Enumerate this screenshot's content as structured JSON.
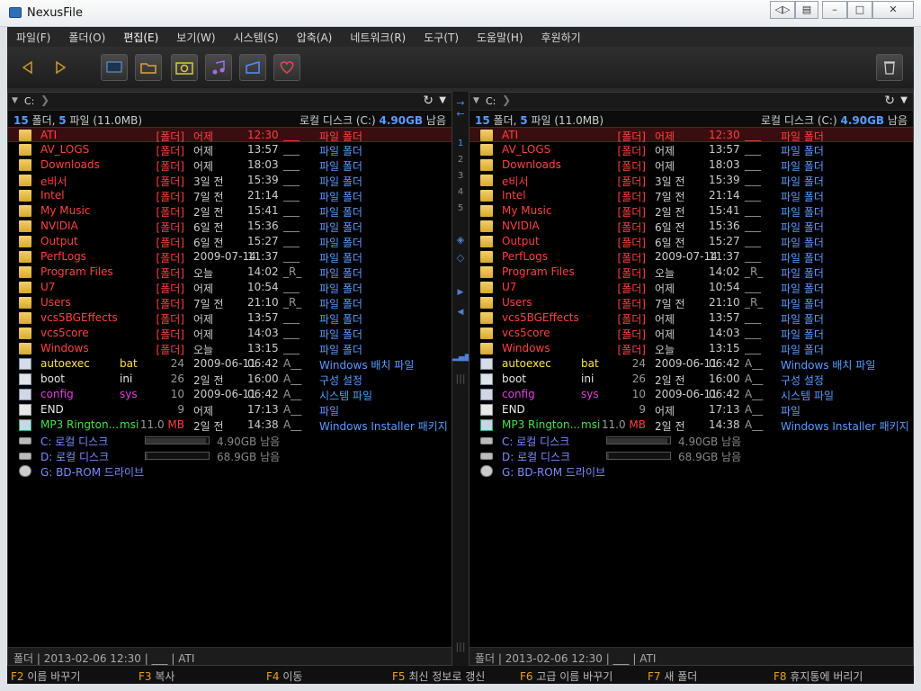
{
  "window": {
    "title": "NexusFile"
  },
  "menu": [
    "파일(F)",
    "폴더(O)",
    "편집(E)",
    "보기(W)",
    "시스템(S)",
    "압축(A)",
    "네트워크(R)",
    "도구(T)",
    "도움말(H)",
    "후원하기"
  ],
  "toolbar": {
    "icons": [
      "back-arrow-icon",
      "forward-arrow-icon",
      "screen-icon",
      "folder-icon",
      "camera-icon",
      "music-note-icon",
      "tag-icon",
      "heart-icon",
      "trash-icon"
    ]
  },
  "center": {
    "arrow_right": "→",
    "arrow_left": "←",
    "numbers": [
      "1",
      "2",
      "3",
      "4",
      "5"
    ]
  },
  "panels": [
    {
      "path": "C:",
      "summary_count": "15",
      "summary_folders": "폴더,",
      "summary_files_count": "5",
      "summary_files": "파일 (11.0MB)",
      "disk_label": "로컬 디스크 (C:)",
      "disk_free": "4.90GB",
      "disk_free_suffix": "남음",
      "status": "폴더  |  2013-02-06 12:30  |  ___  |  ATI"
    },
    {
      "path": "C:",
      "summary_count": "15",
      "summary_folders": "폴더,",
      "summary_files_count": "5",
      "summary_files": "파일 (11.0MB)",
      "disk_label": "로컬 디스크 (C:)",
      "disk_free": "4.90GB",
      "disk_free_suffix": "남음",
      "status": "폴더  |  2013-02-06 12:30  |  ___  |  ATI"
    }
  ],
  "files": [
    {
      "name": "ATI",
      "kind": "folder",
      "size": "[폴더]",
      "date": "어제",
      "time": "12:30",
      "attr": "___",
      "type": "파일 폴더",
      "selected": true
    },
    {
      "name": "AV_LOGS",
      "kind": "folder",
      "size": "[폴더]",
      "date": "어제",
      "time": "13:57",
      "attr": "___",
      "type": "파일 폴더"
    },
    {
      "name": "Downloads",
      "kind": "folder",
      "size": "[폴더]",
      "date": "어제",
      "time": "18:03",
      "attr": "___",
      "type": "파일 폴더"
    },
    {
      "name": "e비서",
      "kind": "folder",
      "size": "[폴더]",
      "date": "3일 전",
      "time": "15:39",
      "attr": "___",
      "type": "파일 폴더"
    },
    {
      "name": "Intel",
      "kind": "folder",
      "size": "[폴더]",
      "date": "7일 전",
      "time": "21:14",
      "attr": "___",
      "type": "파일 폴더"
    },
    {
      "name": "My Music",
      "kind": "folder",
      "size": "[폴더]",
      "date": "2일 전",
      "time": "15:41",
      "attr": "___",
      "type": "파일 폴더"
    },
    {
      "name": "NVIDIA",
      "kind": "folder",
      "size": "[폴더]",
      "date": "6일 전",
      "time": "15:36",
      "attr": "___",
      "type": "파일 폴더"
    },
    {
      "name": "Output",
      "kind": "folder",
      "size": "[폴더]",
      "date": "6일 전",
      "time": "15:27",
      "attr": "___",
      "type": "파일 폴더"
    },
    {
      "name": "PerfLogs",
      "kind": "folder",
      "size": "[폴더]",
      "date": "2009-07-14",
      "time": "11:37",
      "attr": "___",
      "type": "파일 폴더"
    },
    {
      "name": "Program Files",
      "kind": "folder",
      "size": "[폴더]",
      "date": "오늘",
      "time": "14:02",
      "attr": "_R_",
      "type": "파일 폴더"
    },
    {
      "name": "U7",
      "kind": "folder",
      "size": "[폴더]",
      "date": "어제",
      "time": "10:54",
      "attr": "___",
      "type": "파일 폴더"
    },
    {
      "name": "Users",
      "kind": "folder",
      "size": "[폴더]",
      "date": "7일 전",
      "time": "21:10",
      "attr": "_R_",
      "type": "파일 폴더"
    },
    {
      "name": "vcs5BGEffects",
      "kind": "folder",
      "size": "[폴더]",
      "date": "어제",
      "time": "13:57",
      "attr": "___",
      "type": "파일 폴더"
    },
    {
      "name": "vcs5core",
      "kind": "folder",
      "size": "[폴더]",
      "date": "어제",
      "time": "14:03",
      "attr": "___",
      "type": "파일 폴더"
    },
    {
      "name": "Windows",
      "kind": "folder",
      "size": "[폴더]",
      "date": "오늘",
      "time": "13:15",
      "attr": "___",
      "type": "파일 폴더"
    },
    {
      "name": "autoexec",
      "ext": "bat",
      "kind": "bat",
      "size": "24",
      "date": "2009-06-11",
      "time": "06:42",
      "attr": "A__",
      "type": "Windows 배치 파일"
    },
    {
      "name": "boot",
      "ext": "ini",
      "kind": "ini",
      "size": "26",
      "date": "2일 전",
      "time": "16:00",
      "attr": "A__",
      "type": "구성 설정"
    },
    {
      "name": "config",
      "ext": "sys",
      "kind": "sys",
      "size": "10",
      "date": "2009-06-11",
      "time": "06:42",
      "attr": "A__",
      "type": "시스템 파일"
    },
    {
      "name": "END",
      "kind": "file",
      "size": "9",
      "date": "어제",
      "time": "17:13",
      "attr": "A__",
      "type": "파일"
    },
    {
      "name": "MP3 Rington...",
      "ext": "msi",
      "kind": "msi",
      "size": "11.0",
      "size_unit": "MB",
      "date": "2일 전",
      "time": "14:38",
      "attr": "A__",
      "type": "Windows Installer 패키지"
    }
  ],
  "drives": [
    {
      "name": "C: 로컬 디스크",
      "free": "4.90GB 남음",
      "used_fraction": 0.95,
      "icon": "drive-icon"
    },
    {
      "name": "D: 로컬 디스크",
      "free": "68.9GB 남음",
      "used_fraction": 0.03,
      "icon": "drive-icon"
    },
    {
      "name": "G: BD-ROM 드라이브",
      "icon": "cd-drive-icon"
    }
  ],
  "fkeys": [
    {
      "key": "F2",
      "label": "이름 바꾸기"
    },
    {
      "key": "F3",
      "label": "복사"
    },
    {
      "key": "F4",
      "label": "이동"
    },
    {
      "key": "F5",
      "label": "최신 정보로 갱신"
    },
    {
      "key": "F6",
      "label": "고급 이름 바꾸기"
    },
    {
      "key": "F7",
      "label": "새 폴더"
    },
    {
      "key": "F8",
      "label": "휴지통에 버리기"
    }
  ],
  "colors": {
    "folder": "#ff4040",
    "accent_blue": "#5a9bff",
    "bat": "#ffe24a",
    "sys": "#e040e0",
    "msi": "#46e04a",
    "drive": "#7c8cff",
    "fkey": "#e8a020"
  }
}
